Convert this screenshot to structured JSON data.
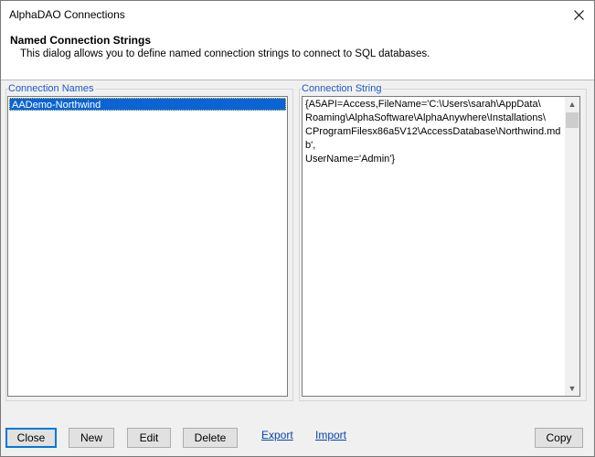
{
  "window": {
    "title": "AlphaDAO Connections"
  },
  "header": {
    "title": "Named Connection Strings",
    "description": "This dialog allows you to define named connection strings to connect to SQL databases."
  },
  "connection_names": {
    "label": "Connection Names",
    "items": [
      "AADemo-Northwind"
    ],
    "selected_index": 0
  },
  "connection_string": {
    "label": "Connection String",
    "value": "{A5API=Access,FileName='C:\\Users\\sarah\\AppData\\\nRoaming\\AlphaSoftware\\AlphaAnywhere\\Installations\\\nCProgramFilesx86a5V12\\AccessDatabase\\Northwind.mdb',\nUserName='Admin'}"
  },
  "buttons": {
    "close": "Close",
    "new": "New",
    "edit": "Edit",
    "delete": "Delete",
    "copy": "Copy"
  },
  "links": {
    "export": "Export",
    "import": "Import"
  },
  "colors": {
    "accent": "#0078d7",
    "selection": "#0a64d6",
    "group_label": "#1e58c8",
    "link": "#0645ad"
  }
}
